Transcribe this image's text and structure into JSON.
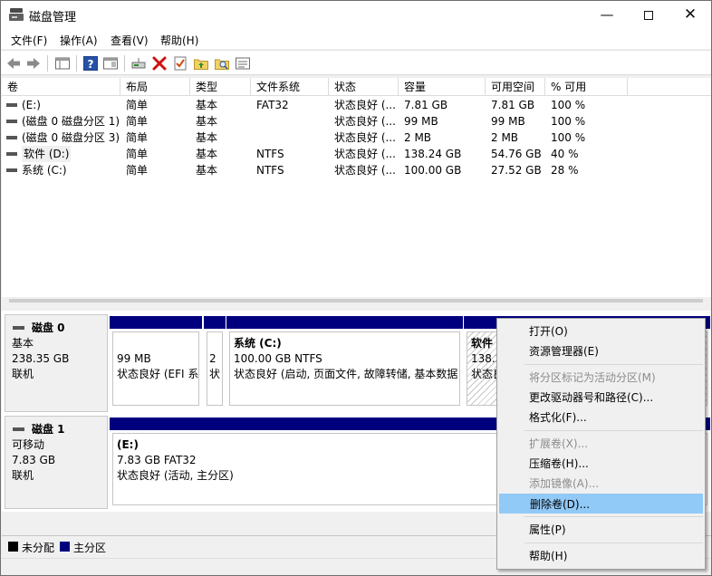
{
  "window": {
    "title": "磁盘管理"
  },
  "titlebar": {
    "min_glyph": "—",
    "close_glyph": "✕"
  },
  "menu": [
    "文件(F)",
    "操作(A)",
    "查看(V)",
    "帮助(H)"
  ],
  "toolbar": {
    "icons": [
      "back-arrow-icon",
      "forward-arrow-icon",
      "console-tree-icon",
      "help-icon",
      "action-pane-icon",
      "connect-drive-icon",
      "delete-x-icon",
      "properties-check-icon",
      "open-folder-up-icon",
      "search-folder-icon",
      "disk-list-icon"
    ],
    "accent_delete": "#d01010",
    "accent_help": "#2552a8"
  },
  "volume_table": {
    "columns": [
      "卷",
      "布局",
      "类型",
      "文件系统",
      "状态",
      "容量",
      "可用空间",
      "% 可用"
    ],
    "rows": [
      [
        "(E:)",
        "简单",
        "基本",
        "FAT32",
        "状态良好 (...",
        "7.81 GB",
        "7.81 GB",
        "100 %"
      ],
      [
        "(磁盘 0 磁盘分区 1)",
        "简单",
        "基本",
        "",
        "状态良好 (...",
        "99 MB",
        "99 MB",
        "100 %"
      ],
      [
        "(磁盘 0 磁盘分区 3)",
        "简单",
        "基本",
        "",
        "状态良好 (...",
        "2 MB",
        "2 MB",
        "100 %"
      ],
      [
        "软件 (D:)",
        "简单",
        "基本",
        "NTFS",
        "状态良好 (...",
        "138.24 GB",
        "54.76 GB",
        "40 %"
      ],
      [
        "系统 (C:)",
        "简单",
        "基本",
        "NTFS",
        "状态良好 (...",
        "100.00 GB",
        "27.52 GB",
        "28 %"
      ]
    ]
  },
  "disks": [
    {
      "name": "磁盘 0",
      "type": "基本",
      "size": "238.35 GB",
      "status": "联机",
      "partitions": [
        {
          "line1": "99 MB",
          "line2": "状态良好 (EFI 系"
        },
        {
          "line1": "2",
          "line2": "状"
        },
        {
          "title": "系统  (C:)",
          "line1": "100.00 GB NTFS",
          "line2": "状态良好 (启动, 页面文件, 故障转储, 基本数据"
        },
        {
          "title": "软件",
          "line1": "138.2",
          "line2": "状态良"
        }
      ]
    },
    {
      "name": "磁盘 1",
      "type": "可移动",
      "size": "7.83 GB",
      "status": "联机",
      "partitions": [
        {
          "title": "(E:)",
          "line1": "7.83 GB FAT32",
          "line2": "状态良好 (活动, 主分区)"
        }
      ]
    }
  ],
  "legend": {
    "items": [
      {
        "label": "未分配",
        "color": "#000000"
      },
      {
        "label": "主分区",
        "color": "#00007f"
      }
    ]
  },
  "context_menu": {
    "items": [
      {
        "label": "打开(O)",
        "enabled": true
      },
      {
        "label": "资源管理器(E)",
        "enabled": true
      },
      {
        "label": "将分区标记为活动分区(M)",
        "enabled": false
      },
      {
        "label": "更改驱动器号和路径(C)...",
        "enabled": true
      },
      {
        "label": "格式化(F)...",
        "enabled": true
      },
      {
        "label": "扩展卷(X)...",
        "enabled": false
      },
      {
        "label": "压缩卷(H)...",
        "enabled": true
      },
      {
        "label": "添加镜像(A)...",
        "enabled": false
      },
      {
        "label": "删除卷(D)...",
        "enabled": true,
        "highlighted": true
      },
      {
        "label": "属性(P)",
        "enabled": true
      },
      {
        "label": "帮助(H)",
        "enabled": true
      }
    ],
    "highlight_color": "#91c9f7"
  }
}
